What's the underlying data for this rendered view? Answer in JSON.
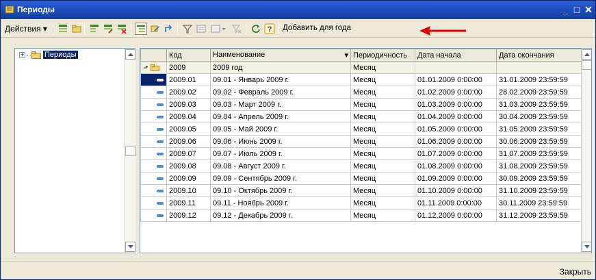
{
  "window": {
    "title": "Периоды"
  },
  "toolbar": {
    "actions_label": "Действия",
    "add_for_year_label": "Добавить для года",
    "help_glyph": "?"
  },
  "tree": {
    "root_label": "Периоды",
    "expander": "+"
  },
  "grid": {
    "headers": {
      "kod": "Код",
      "name": "Наименование",
      "periodicity": "Периодичность",
      "start": "Дата начала",
      "end": "Дата окончания"
    },
    "group_row": {
      "kod": "2009",
      "name": "2009 год",
      "periodicity": "Месяц"
    },
    "rows": [
      {
        "kod": "2009.01",
        "name": "09.01 - Январь 2009 г.",
        "periodicity": "Месяц",
        "start": "01.01.2009 0:00:00",
        "end": "31.01.2009 23:59:59"
      },
      {
        "kod": "2009.02",
        "name": "09.02 - Февраль 2009 г.",
        "periodicity": "Месяц",
        "start": "01.02.2009 0:00:00",
        "end": "28.02.2009 23:59:59"
      },
      {
        "kod": "2009.03",
        "name": "09.03 - Март 2009 г.",
        "periodicity": "Месяц",
        "start": "01.03.2009 0:00:00",
        "end": "31.03.2009 23:59:59"
      },
      {
        "kod": "2009.04",
        "name": "09.04 - Апрель 2009 г.",
        "periodicity": "Месяц",
        "start": "01.04.2009 0:00:00",
        "end": "30.04.2009 23:59:59"
      },
      {
        "kod": "2009.05",
        "name": "09.05 - Май 2009 г.",
        "periodicity": "Месяц",
        "start": "01.05.2009 0:00:00",
        "end": "31.05.2009 23:59:59"
      },
      {
        "kod": "2009.06",
        "name": "09.06 - Июнь 2009 г.",
        "periodicity": "Месяц",
        "start": "01.06.2009 0:00:00",
        "end": "30.06.2009 23:59:59"
      },
      {
        "kod": "2009.07",
        "name": "09.07 - Июль 2009 г.",
        "periodicity": "Месяц",
        "start": "01.07.2009 0:00:00",
        "end": "31.07.2009 23:59:59"
      },
      {
        "kod": "2009.08",
        "name": "09.08 - Август 2009 г.",
        "periodicity": "Месяц",
        "start": "01.08.2009 0:00:00",
        "end": "31.08.2009 23:59:59"
      },
      {
        "kod": "2009.09",
        "name": "09.09 - Сентябрь 2009 г.",
        "periodicity": "Месяц",
        "start": "01.09.2009 0:00:00",
        "end": "30.09.2009 23:59:59"
      },
      {
        "kod": "2009.10",
        "name": "09.10 - Октябрь 2009 г.",
        "periodicity": "Месяц",
        "start": "01.10.2009 0:00:00",
        "end": "31.10.2009 23:59:59"
      },
      {
        "kod": "2009.11",
        "name": "09.11 - Ноябрь 2009 г.",
        "periodicity": "Месяц",
        "start": "01.11.2009 0:00:00",
        "end": "30.11.2009 23:59:59"
      },
      {
        "kod": "2009.12",
        "name": "09.12 - Декабрь 2009 г.",
        "periodicity": "Месяц",
        "start": "01.12.2009 0:00:00",
        "end": "31.12.2009 23:59:59"
      }
    ]
  },
  "footer": {
    "close_label": "Закрыть"
  },
  "colors": {
    "title_bar": "#1f4fc0",
    "selection": "#0a246a",
    "arrow": "#e00000"
  },
  "icons": [
    "window-icon",
    "minimize-icon",
    "maximize-icon",
    "close-icon",
    "folder-icon",
    "element-icon",
    "group-icon",
    "help-icon",
    "refresh-icon",
    "filter-icon",
    "annotation-arrow-icon"
  ]
}
